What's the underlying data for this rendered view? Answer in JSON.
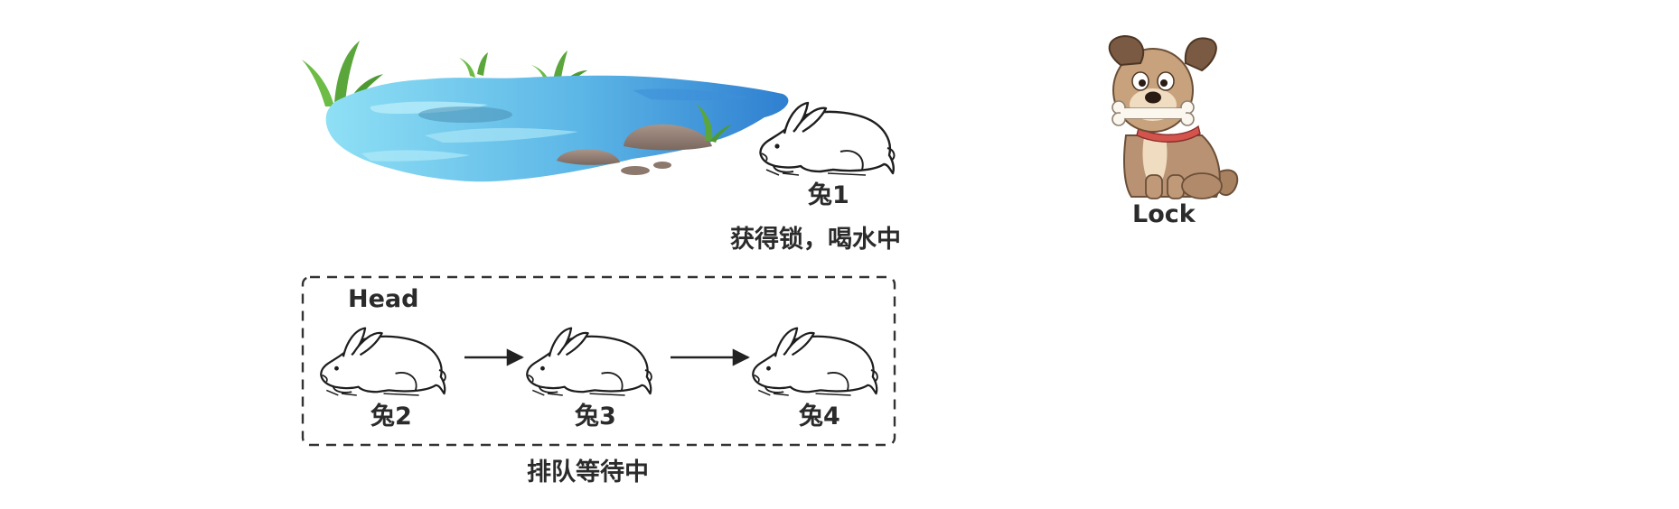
{
  "scene": {
    "drinking_rabbit": {
      "name": "兔1",
      "status": "获得锁，喝水中"
    },
    "lock": {
      "label": "Lock"
    },
    "queue": {
      "head_label": "Head",
      "caption": "排队等待中",
      "rabbits": [
        {
          "name": "兔2"
        },
        {
          "name": "兔3"
        },
        {
          "name": "兔4"
        }
      ]
    }
  }
}
